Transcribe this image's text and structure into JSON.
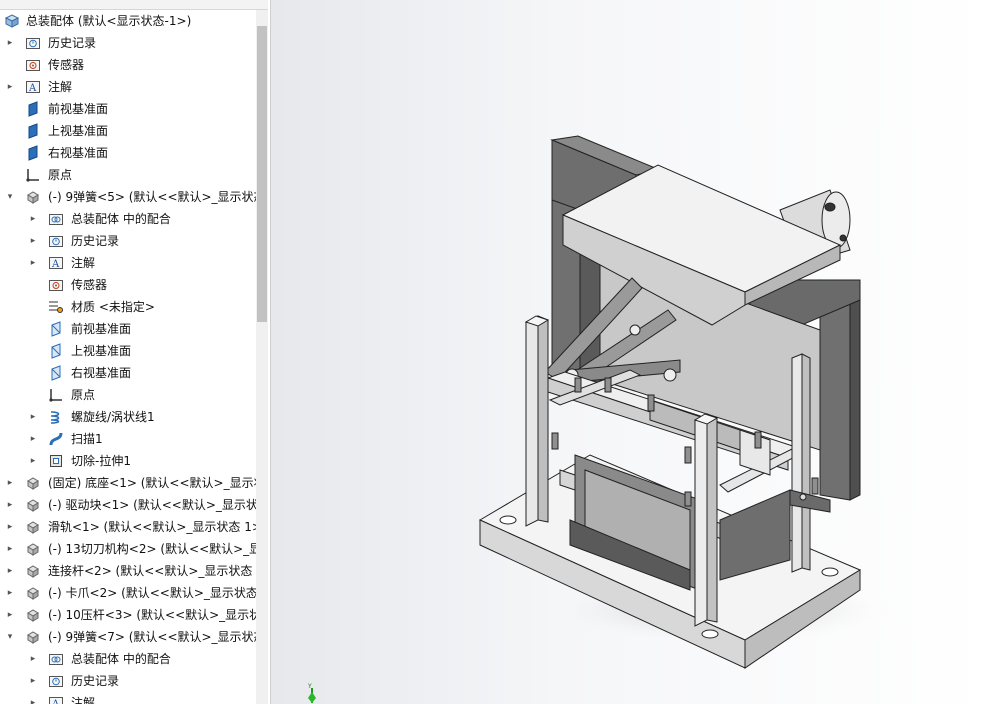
{
  "tree": {
    "items": [
      {
        "label": "总装配体 (默认<显示状态-1>)",
        "icon": "assembly-icon",
        "level": 0,
        "expand": "none"
      },
      {
        "label": "历史记录",
        "icon": "history-folder-icon",
        "level": 1,
        "expand": "right"
      },
      {
        "label": "传感器",
        "icon": "sensor-folder-icon",
        "level": 1,
        "expand": "none"
      },
      {
        "label": "注解",
        "icon": "annotation-folder-icon",
        "level": 1,
        "expand": "right"
      },
      {
        "label": "前视基准面",
        "icon": "plane-icon",
        "level": 1,
        "expand": "none"
      },
      {
        "label": "上视基准面",
        "icon": "plane-icon",
        "level": 1,
        "expand": "none"
      },
      {
        "label": "右视基准面",
        "icon": "plane-icon",
        "level": 1,
        "expand": "none"
      },
      {
        "label": "原点",
        "icon": "origin-icon",
        "level": 1,
        "expand": "none"
      },
      {
        "label": "(-) 9弹簧<5> (默认<<默认>_显示状态",
        "icon": "part-icon",
        "level": 1,
        "expand": "down"
      },
      {
        "label": "总装配体 中的配合",
        "icon": "mates-folder-icon",
        "level": 2,
        "expand": "right"
      },
      {
        "label": "历史记录",
        "icon": "history-folder-icon",
        "level": 2,
        "expand": "right"
      },
      {
        "label": "注解",
        "icon": "annotation-folder-icon",
        "level": 2,
        "expand": "right"
      },
      {
        "label": "传感器",
        "icon": "sensor-folder-icon",
        "level": 2,
        "expand": "none"
      },
      {
        "label": "材质 <未指定>",
        "icon": "material-icon",
        "level": 2,
        "expand": "none"
      },
      {
        "label": "前视基准面",
        "icon": "plane-outline-icon",
        "level": 2,
        "expand": "none"
      },
      {
        "label": "上视基准面",
        "icon": "plane-outline-icon",
        "level": 2,
        "expand": "none"
      },
      {
        "label": "右视基准面",
        "icon": "plane-outline-icon",
        "level": 2,
        "expand": "none"
      },
      {
        "label": "原点",
        "icon": "origin-icon",
        "level": 2,
        "expand": "none"
      },
      {
        "label": "螺旋线/涡状线1",
        "icon": "helix-icon",
        "level": 2,
        "expand": "right"
      },
      {
        "label": "扫描1",
        "icon": "sweep-icon",
        "level": 2,
        "expand": "right"
      },
      {
        "label": "切除-拉伸1",
        "icon": "cut-extrude-icon",
        "level": 2,
        "expand": "right"
      },
      {
        "label": "(固定) 底座<1> (默认<<默认>_显示状",
        "icon": "part-icon",
        "level": 1,
        "expand": "right"
      },
      {
        "label": "(-) 驱动块<1> (默认<<默认>_显示状",
        "icon": "part-icon",
        "level": 1,
        "expand": "right"
      },
      {
        "label": "滑轨<1> (默认<<默认>_显示状态 1>)",
        "icon": "part-icon",
        "level": 1,
        "expand": "right"
      },
      {
        "label": "(-) 13切刀机构<2> (默认<<默认>_显",
        "icon": "part-icon",
        "level": 1,
        "expand": "right"
      },
      {
        "label": "连接杆<2> (默认<<默认>_显示状态 1",
        "icon": "part-icon",
        "level": 1,
        "expand": "right"
      },
      {
        "label": "(-) 卡爪<2> (默认<<默认>_显示状态",
        "icon": "part-icon",
        "level": 1,
        "expand": "right"
      },
      {
        "label": "(-) 10压杆<3> (默认<<默认>_显示状态",
        "icon": "part-icon",
        "level": 1,
        "expand": "right"
      },
      {
        "label": "(-) 9弹簧<7> (默认<<默认>_显示状态",
        "icon": "part-icon",
        "level": 1,
        "expand": "down"
      },
      {
        "label": "总装配体 中的配合",
        "icon": "mates-folder-icon",
        "level": 2,
        "expand": "right"
      },
      {
        "label": "历史记录",
        "icon": "history-folder-icon",
        "level": 2,
        "expand": "right"
      },
      {
        "label": "注解",
        "icon": "annotation-folder-icon",
        "level": 2,
        "expand": "right"
      }
    ]
  },
  "viewport": {
    "model_icon": "assembly-model-3d",
    "triad_icon": "axis-triad-icon",
    "triad_label": "Y"
  },
  "colors": {
    "background_left": "#e6e8ec",
    "background_right": "#ffffff",
    "plane_icon": "#2a6fb8",
    "part_icon": "#8a8a8a"
  }
}
